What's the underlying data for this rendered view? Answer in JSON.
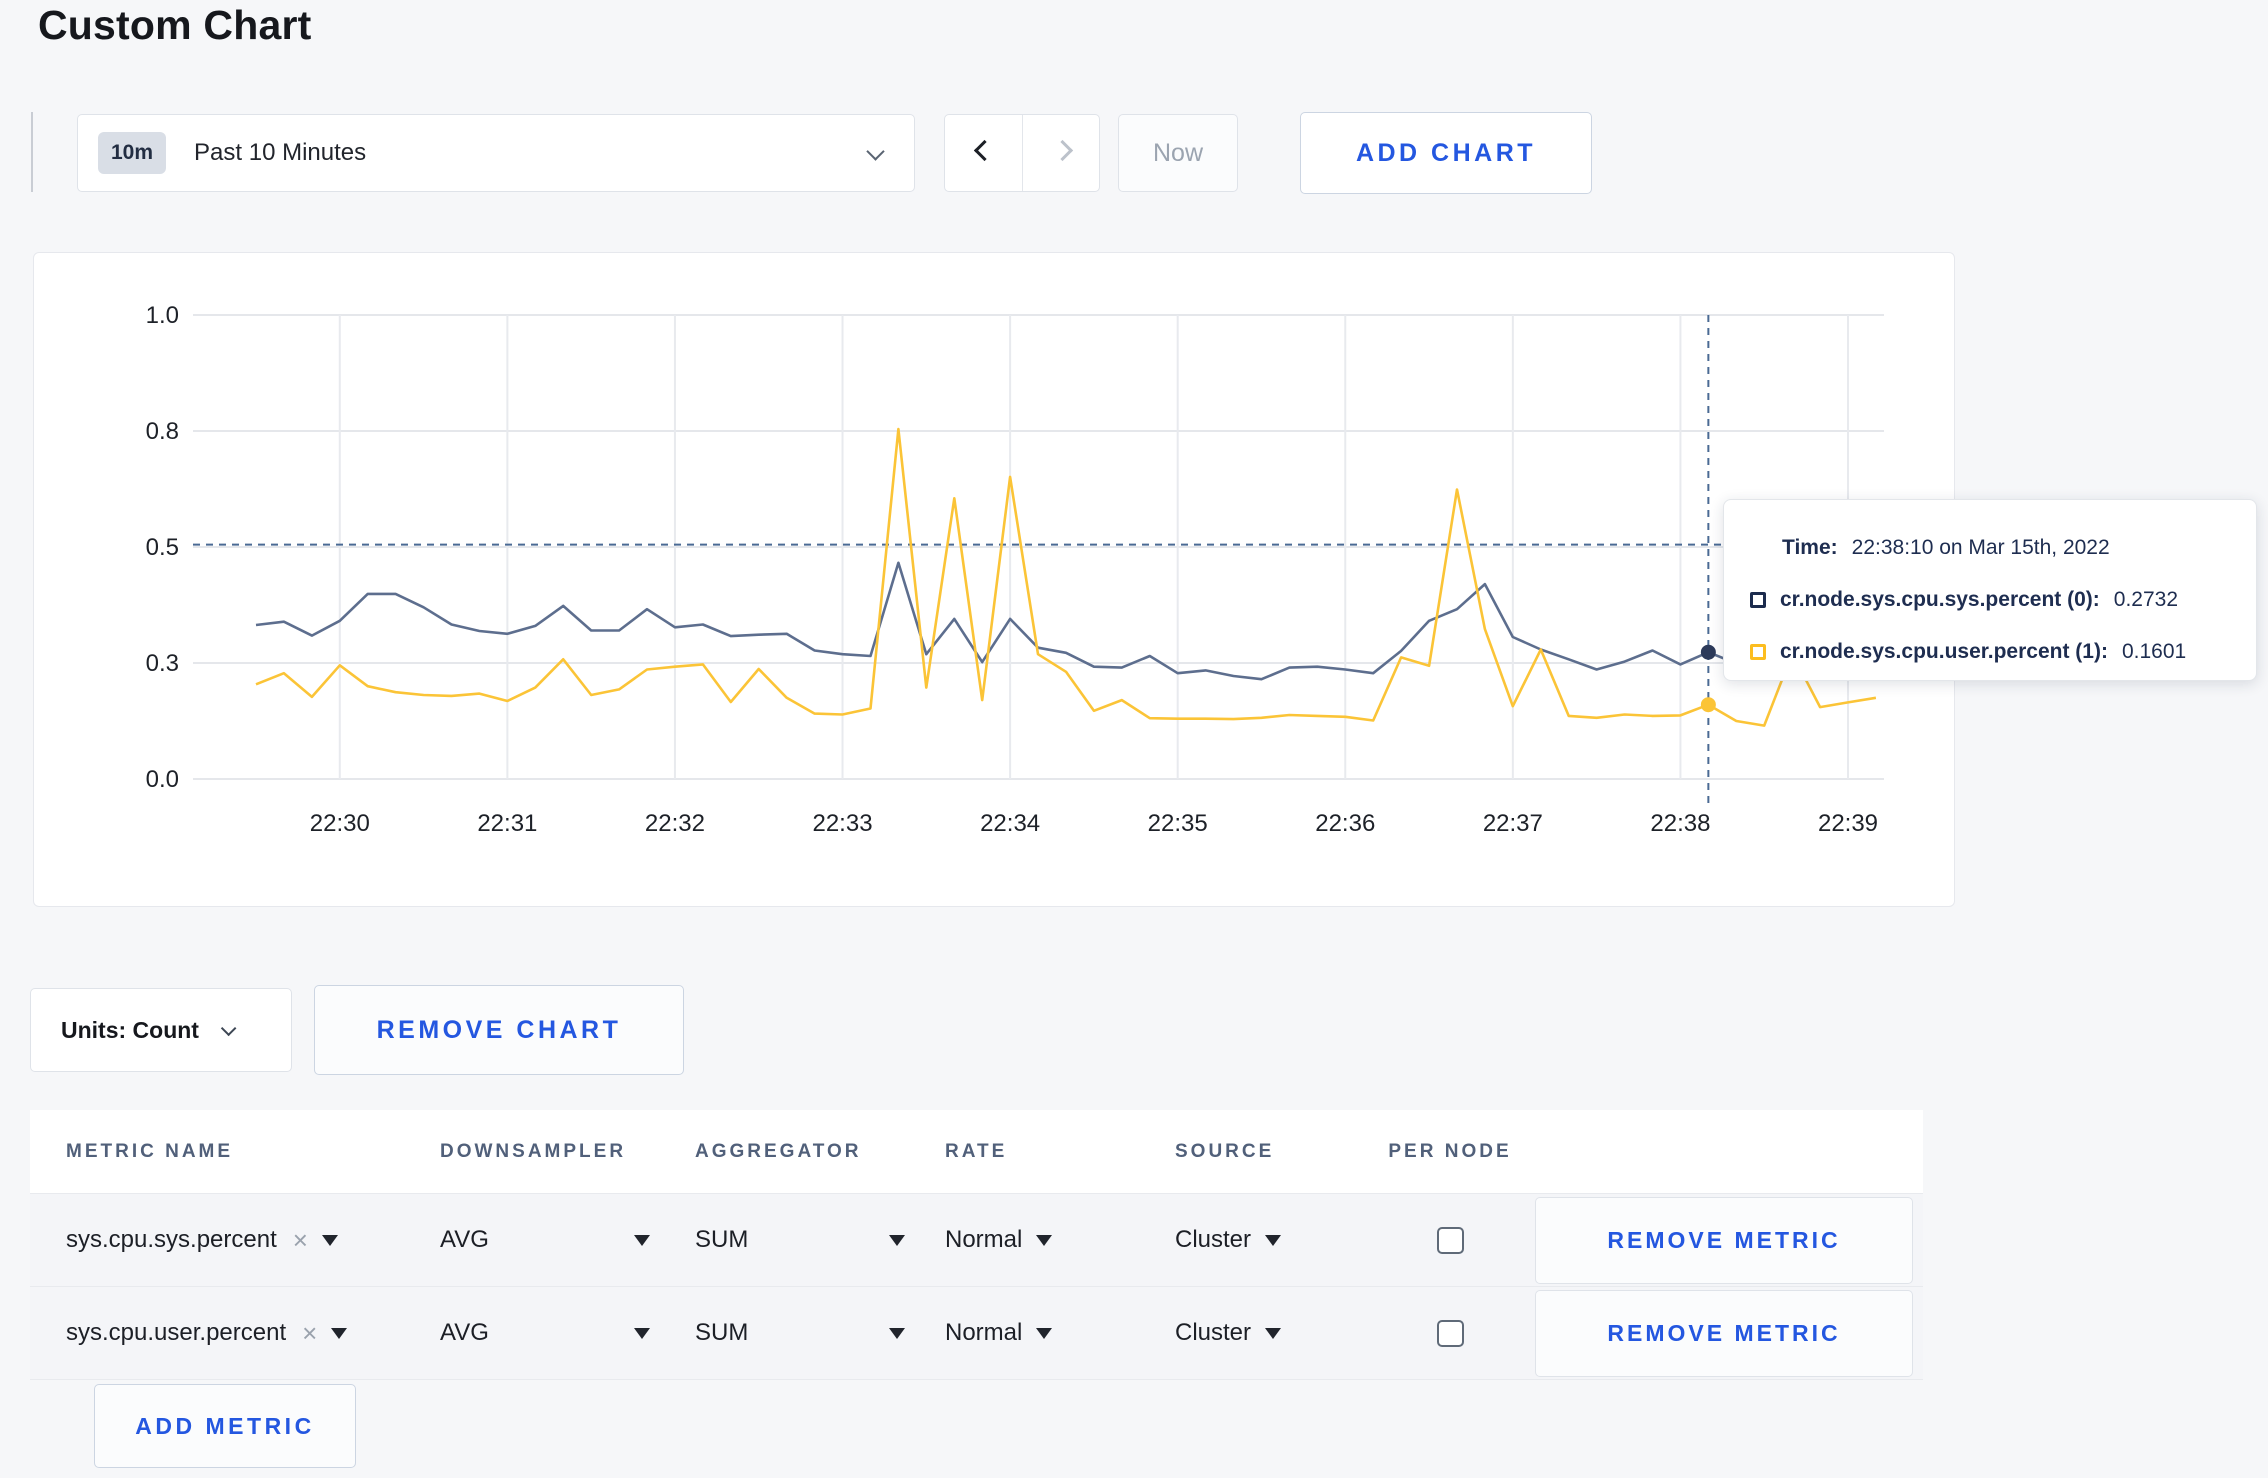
{
  "page_title": "Custom Chart",
  "toolbar": {
    "time_badge": "10m",
    "time_label": "Past 10 Minutes",
    "now_label": "Now",
    "add_chart_label": "ADD CHART"
  },
  "chart_data": {
    "type": "line",
    "title": "",
    "xlabel": "",
    "ylabel": "",
    "ylim": [
      0,
      1
    ],
    "grid": true,
    "legend_position": "tooltip-on-hover",
    "y_ticks": [
      {
        "value": 0.0,
        "label": "0.0"
      },
      {
        "value": 0.25,
        "label": "0.3"
      },
      {
        "value": 0.5,
        "label": "0.5"
      },
      {
        "value": 0.75,
        "label": "0.8"
      },
      {
        "value": 1.0,
        "label": "1.0"
      }
    ],
    "x_ticks": [
      "22:30",
      "22:31",
      "22:32",
      "22:33",
      "22:34",
      "22:35",
      "22:36",
      "22:37",
      "22:38",
      "22:39"
    ],
    "x_tick_indices": [
      3,
      9,
      15,
      21,
      27,
      33,
      39,
      45,
      51,
      57
    ],
    "interval_seconds": 10,
    "times": [
      "22:29:30",
      "22:29:40",
      "22:29:50",
      "22:30:00",
      "22:30:10",
      "22:30:20",
      "22:30:30",
      "22:30:40",
      "22:30:50",
      "22:31:00",
      "22:31:10",
      "22:31:20",
      "22:31:30",
      "22:31:40",
      "22:31:50",
      "22:32:00",
      "22:32:10",
      "22:32:20",
      "22:32:30",
      "22:32:40",
      "22:32:50",
      "22:33:00",
      "22:33:10",
      "22:33:20",
      "22:33:30",
      "22:33:40",
      "22:33:50",
      "22:34:00",
      "22:34:10",
      "22:34:20",
      "22:34:30",
      "22:34:40",
      "22:34:50",
      "22:35:00",
      "22:35:10",
      "22:35:20",
      "22:35:30",
      "22:35:40",
      "22:35:50",
      "22:36:00",
      "22:36:10",
      "22:36:20",
      "22:36:30",
      "22:36:40",
      "22:36:50",
      "22:37:00",
      "22:37:10",
      "22:37:20",
      "22:37:30",
      "22:37:40",
      "22:37:50",
      "22:38:00",
      "22:38:10",
      "22:38:20",
      "22:38:30",
      "22:38:40",
      "22:38:50",
      "22:39:00",
      "22:39:10"
    ],
    "series": [
      {
        "name": "cr.node.sys.cpu.sys.percent",
        "node": "0",
        "color": "#5d6e8e",
        "values": [
          0.332,
          0.339,
          0.309,
          0.341,
          0.399,
          0.399,
          0.37,
          0.333,
          0.319,
          0.313,
          0.33,
          0.373,
          0.32,
          0.32,
          0.366,
          0.327,
          0.333,
          0.308,
          0.311,
          0.313,
          0.277,
          0.269,
          0.265,
          0.466,
          0.269,
          0.345,
          0.252,
          0.345,
          0.283,
          0.272,
          0.242,
          0.24,
          0.265,
          0.228,
          0.234,
          0.222,
          0.215,
          0.24,
          0.242,
          0.236,
          0.228,
          0.276,
          0.341,
          0.366,
          0.42,
          0.306,
          0.279,
          0.258,
          0.236,
          0.253,
          0.277,
          0.247,
          0.2732,
          0.249,
          0.252,
          0.248,
          0.255,
          0.252,
          0.25
        ]
      },
      {
        "name": "cr.node.sys.cpu.user.percent",
        "node": "1",
        "color": "#fbc437",
        "values": [
          0.204,
          0.228,
          0.177,
          0.245,
          0.2,
          0.187,
          0.181,
          0.179,
          0.184,
          0.168,
          0.197,
          0.258,
          0.181,
          0.193,
          0.236,
          0.242,
          0.247,
          0.166,
          0.237,
          0.175,
          0.141,
          0.139,
          0.152,
          0.754,
          0.197,
          0.605,
          0.17,
          0.651,
          0.269,
          0.231,
          0.147,
          0.17,
          0.131,
          0.13,
          0.13,
          0.129,
          0.132,
          0.138,
          0.136,
          0.134,
          0.126,
          0.262,
          0.244,
          0.624,
          0.323,
          0.157,
          0.279,
          0.136,
          0.132,
          0.139,
          0.136,
          0.137,
          0.1601,
          0.125,
          0.115,
          0.27,
          0.155,
          0.165,
          0.175
        ]
      }
    ],
    "crosshair": {
      "index": 52,
      "time": "22:38:10",
      "y_value": 0.505
    }
  },
  "tooltip": {
    "time_label": "Time:",
    "time_value": "22:38:10 on Mar 15th, 2022",
    "series": [
      {
        "label": "cr.node.sys.cpu.sys.percent (0):",
        "value": "0.2732",
        "color": "#1b2b4d"
      },
      {
        "label": "cr.node.sys.cpu.user.percent (1):",
        "value": "0.1601",
        "color": "#fcbd1f"
      }
    ]
  },
  "chart_controls": {
    "units_label": "Units: Count",
    "remove_chart_label": "REMOVE CHART"
  },
  "metrics_table": {
    "columns": [
      "METRIC NAME",
      "DOWNSAMPLER",
      "AGGREGATOR",
      "RATE",
      "SOURCE",
      "PER NODE"
    ],
    "rows": [
      {
        "metric_name": "sys.cpu.sys.percent",
        "downsampler": "AVG",
        "aggregator": "SUM",
        "rate": "Normal",
        "source": "Cluster",
        "per_node_checked": false,
        "remove_label": "REMOVE METRIC"
      },
      {
        "metric_name": "sys.cpu.user.percent",
        "downsampler": "AVG",
        "aggregator": "SUM",
        "rate": "Normal",
        "source": "Cluster",
        "per_node_checked": false,
        "remove_label": "REMOVE METRIC"
      }
    ],
    "add_metric_label": "ADD METRIC"
  }
}
